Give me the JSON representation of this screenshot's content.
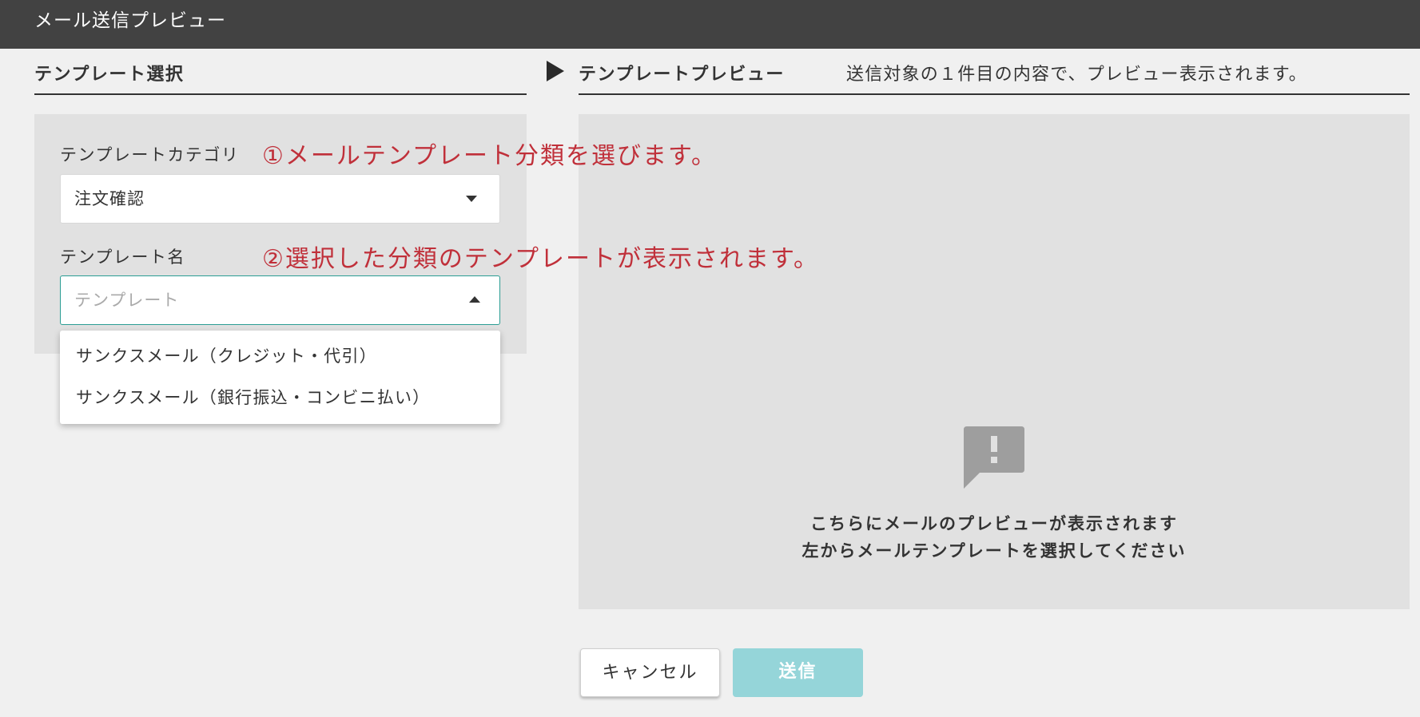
{
  "window": {
    "title": "メール送信プレビュー"
  },
  "left": {
    "heading": "テンプレート選択",
    "category_label": "テンプレートカテゴリ",
    "category_value": "注文確認",
    "name_label": "テンプレート名",
    "name_placeholder": "テンプレート",
    "options": [
      "サンクスメール（クレジット・代引）",
      "サンクスメール（銀行振込・コンビニ払い）"
    ]
  },
  "right": {
    "heading": "テンプレートプレビュー",
    "note": "送信対象の１件目の内容で、プレビュー表示されます。",
    "empty_line1": "こちらにメールのプレビューが表示されます",
    "empty_line2": "左からメールテンプレートを選択してください",
    "icon": "feedback-alert-icon"
  },
  "annotations": {
    "step1": "①メールテンプレート分類を選びます。",
    "step2": "②選択した分類のテンプレートが表示されます。"
  },
  "buttons": {
    "cancel": "キャンセル",
    "send": "送信"
  },
  "colors": {
    "titlebar": "#424242",
    "accent_border": "#2a9d93",
    "send_disabled": "#95d5d9",
    "annotation": "#c0303a"
  }
}
